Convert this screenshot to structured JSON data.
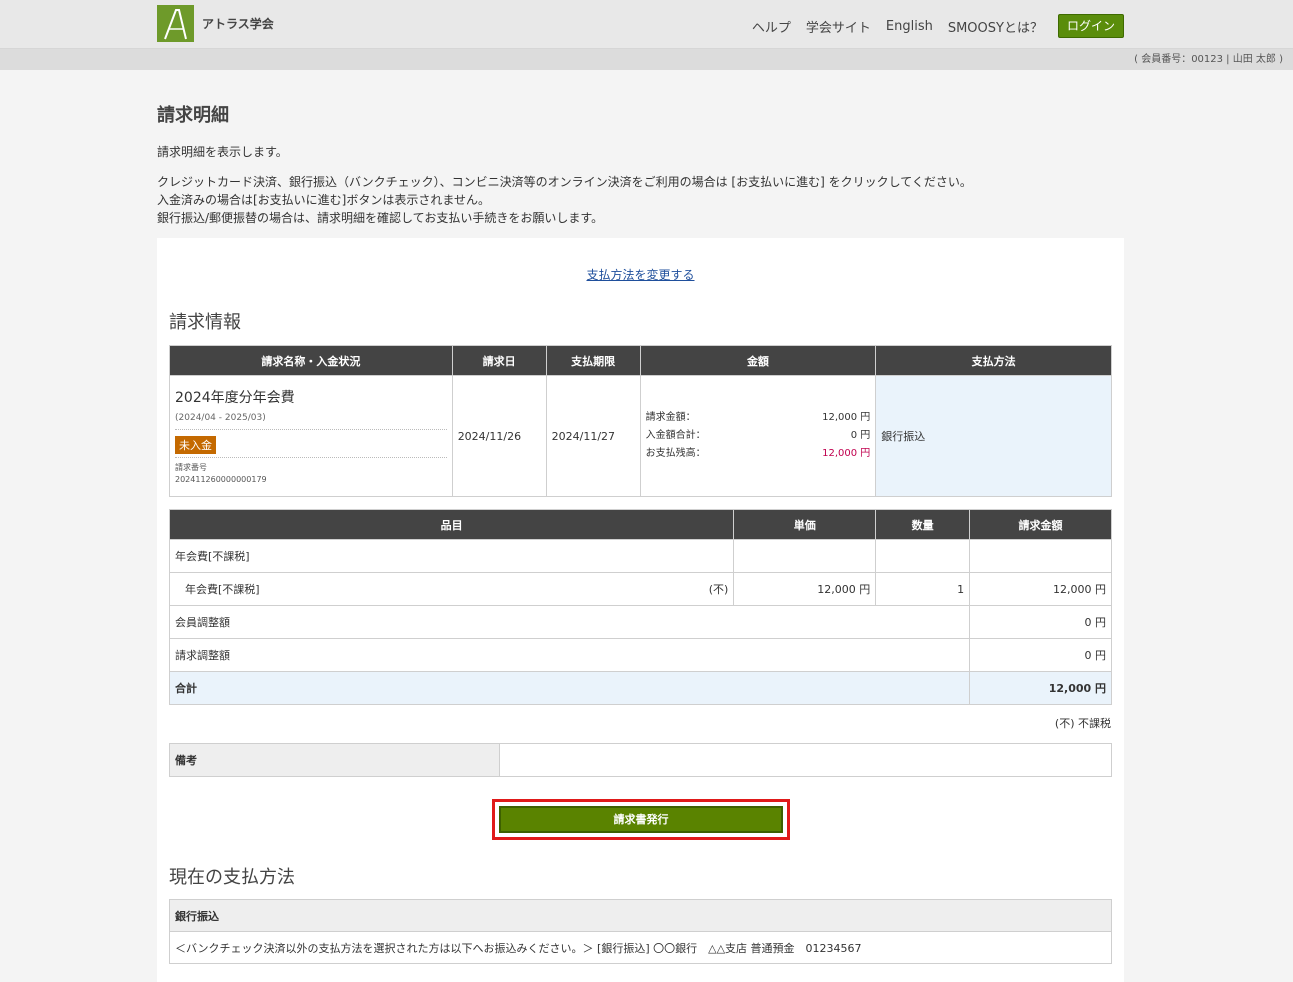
{
  "header": {
    "society_name": "アトラス学会",
    "nav": [
      "ヘルプ",
      "学会サイト",
      "English",
      "SMOOSYとは？"
    ],
    "login_label": "ログイン"
  },
  "member_info": "( 会員番号：00123 | 山田 太郎 )",
  "page": {
    "title": "請求明細",
    "intro_1": "請求明細を表示します。",
    "intro_2": "クレジットカード決済、銀行振込（バンクチェック）、コンビニ決済等のオンライン決済をご利用の場合は [お支払いに進む] をクリックしてください。",
    "intro_3": "入金済みの場合は[お支払いに進む]ボタンは表示されません。",
    "intro_4": "銀行振込/郵便振替の場合は、請求明細を確認してお支払い手続きをお願いします。"
  },
  "change_payment_link": "支払方法を変更する",
  "billing_section_title": "請求情報",
  "billing_table": {
    "headers": [
      "請求名称・入金状況",
      "請求日",
      "支払期限",
      "金額",
      "支払方法"
    ],
    "name": "2024年度分年会費",
    "period": "(2024/04 - 2025/03)",
    "status": "未入金",
    "bill_number_label": "請求番号",
    "bill_number": "202411260000000179",
    "bill_date": "2024/11/26",
    "due_date": "2024/11/27",
    "amount_label": "請求金額：",
    "amount": "12,000 円",
    "paid_label": "入金額合計：",
    "paid": "0 円",
    "balance_label": "お支払残高：",
    "balance": "12,000 円",
    "payment_method": "銀行振込"
  },
  "items_table": {
    "headers": [
      "品目",
      "単価",
      "数量",
      "請求金額"
    ],
    "group": "年会費[不課税]",
    "item_name": "年会費[不課税]",
    "item_tax": "(不)",
    "item_price": "12,000 円",
    "item_qty": "1",
    "item_total": "12,000 円",
    "member_adjust_label": "会員調整額",
    "member_adjust": "0 円",
    "bill_adjust_label": "請求調整額",
    "bill_adjust": "0 円",
    "total_label": "合計",
    "total": "12,000 円"
  },
  "tax_note": "(不) 不課税",
  "remarks_label": "備考",
  "remarks": "",
  "issue_button": "請求書発行",
  "current_payment_title": "現在の支払方法",
  "current_payment": {
    "method": "銀行振込",
    "detail": "＜バンクチェック決済以外の支払方法を選択された方は以下へお振込みください。＞ [銀行振込] 〇〇銀行　△△支店 普通預金　01234567"
  },
  "colors": {
    "accent_green": "#5a8300",
    "header_dark": "#444444",
    "highlight_red": "#e01a1a",
    "status_orange": "#c46900"
  }
}
